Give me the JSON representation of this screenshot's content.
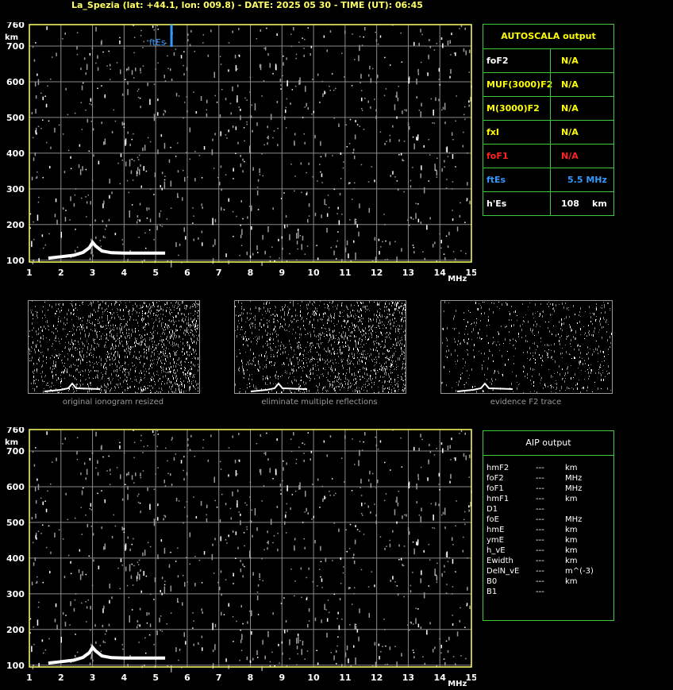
{
  "title": "La_Spezia (lat: +44.1, lon: 009.8) - DATE: 2025 05 30 - TIME (UT): 06:45",
  "colors": {
    "frame": "#ffff66",
    "grid": "#8a8a8a",
    "trace": "#ffffff",
    "es_marker": "#3399ff",
    "table_border": "#3ec83e",
    "value": "#ffff00",
    "fof1": "#ff2222",
    "ftes": "#3399ff"
  },
  "chart_data": [
    {
      "type": "scatter",
      "panel": "main ionogram",
      "xlabel": "MHz",
      "ylabel": "km",
      "xlim": [
        1,
        15
      ],
      "ylim": [
        95,
        760
      ],
      "xticks": [
        1,
        2,
        3,
        4,
        5,
        6,
        7,
        8,
        9,
        10,
        11,
        12,
        13,
        14,
        15
      ],
      "yticks": [
        100,
        200,
        300,
        400,
        500,
        600,
        700,
        760
      ],
      "grid": true,
      "es_marker": {
        "label": "ftEs",
        "freq_mhz": 5.5
      },
      "es_trace": [
        [
          1.6,
          106
        ],
        [
          2.0,
          110
        ],
        [
          2.4,
          114
        ],
        [
          2.7,
          122
        ],
        [
          2.9,
          135
        ],
        [
          3.0,
          150
        ],
        [
          3.1,
          140
        ],
        [
          3.3,
          126
        ],
        [
          3.6,
          121
        ],
        [
          4.0,
          120
        ],
        [
          4.5,
          120
        ],
        [
          5.0,
          120
        ],
        [
          5.3,
          120
        ]
      ]
    },
    {
      "type": "scatter",
      "panel": "AIP ionogram",
      "xlabel": "MHz",
      "ylabel": "km",
      "xlim": [
        1,
        15
      ],
      "ylim": [
        95,
        760
      ],
      "xticks": [
        1,
        2,
        3,
        4,
        5,
        6,
        7,
        8,
        9,
        10,
        11,
        12,
        13,
        14,
        15
      ],
      "yticks": [
        100,
        200,
        300,
        400,
        500,
        600,
        700,
        760
      ],
      "grid": true,
      "es_trace": [
        [
          1.6,
          106
        ],
        [
          2.0,
          110
        ],
        [
          2.4,
          114
        ],
        [
          2.7,
          122
        ],
        [
          2.9,
          135
        ],
        [
          3.0,
          150
        ],
        [
          3.1,
          140
        ],
        [
          3.3,
          126
        ],
        [
          3.6,
          121
        ],
        [
          4.0,
          120
        ],
        [
          4.5,
          120
        ],
        [
          5.0,
          120
        ],
        [
          5.3,
          120
        ]
      ]
    }
  ],
  "autoscala": {
    "header": "AUTOSCALA output",
    "rows": [
      {
        "name": "foF2",
        "value": "N/A",
        "unit": ""
      },
      {
        "name": "MUF(3000)F2",
        "value": "N/A",
        "unit": ""
      },
      {
        "name": "M(3000)F2",
        "value": "N/A",
        "unit": ""
      },
      {
        "name": "fxI",
        "value": "N/A",
        "unit": ""
      },
      {
        "name": "foF1",
        "value": "N/A",
        "unit": ""
      },
      {
        "name": "ftEs",
        "value": "5.5 MHz",
        "unit": ""
      },
      {
        "name": "h'Es",
        "value": "108",
        "unit": "km"
      }
    ]
  },
  "aip": {
    "header": "AIP output",
    "rows": [
      {
        "name": "hmF2",
        "value": "---",
        "unit": "km"
      },
      {
        "name": "foF2",
        "value": "---",
        "unit": "MHz"
      },
      {
        "name": "foF1",
        "value": "---",
        "unit": "MHz"
      },
      {
        "name": "hmF1",
        "value": "---",
        "unit": "km"
      },
      {
        "name": "D1",
        "value": "---",
        "unit": ""
      },
      {
        "name": "foE",
        "value": "---",
        "unit": "MHz"
      },
      {
        "name": "hmE",
        "value": "---",
        "unit": "km"
      },
      {
        "name": "ymE",
        "value": "---",
        "unit": "km"
      },
      {
        "name": "h_vE",
        "value": "---",
        "unit": "km"
      },
      {
        "name": "Ewidth",
        "value": "---",
        "unit": "km"
      },
      {
        "name": "DelN_vE",
        "value": "---",
        "unit": "m^(-3)"
      },
      {
        "name": "B0",
        "value": "---",
        "unit": "km"
      },
      {
        "name": "B1",
        "value": "---",
        "unit": ""
      }
    ]
  },
  "thumbnails": [
    {
      "caption": "original ionogram resized"
    },
    {
      "caption": "eliminate multiple reflections"
    },
    {
      "caption": "evidence F2 trace"
    }
  ]
}
